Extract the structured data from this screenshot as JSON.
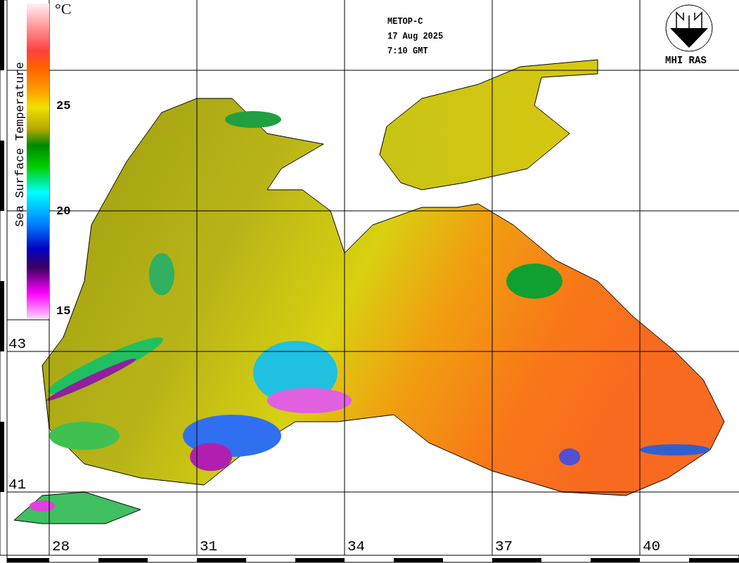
{
  "header": {
    "lines": [
      "METOP-C",
      "17 Aug 2025",
      "7:10 GMT"
    ]
  },
  "logo": {
    "caption": "MHI RAS"
  },
  "color_scale": {
    "title": "Sea Surface Temperature",
    "unit": "°C",
    "ticks": [
      "25",
      "20",
      "15"
    ]
  },
  "map": {
    "latitude_labels": [
      "43",
      "41"
    ],
    "longitude_labels": [
      "28",
      "31",
      "34",
      "37",
      "40"
    ]
  }
}
